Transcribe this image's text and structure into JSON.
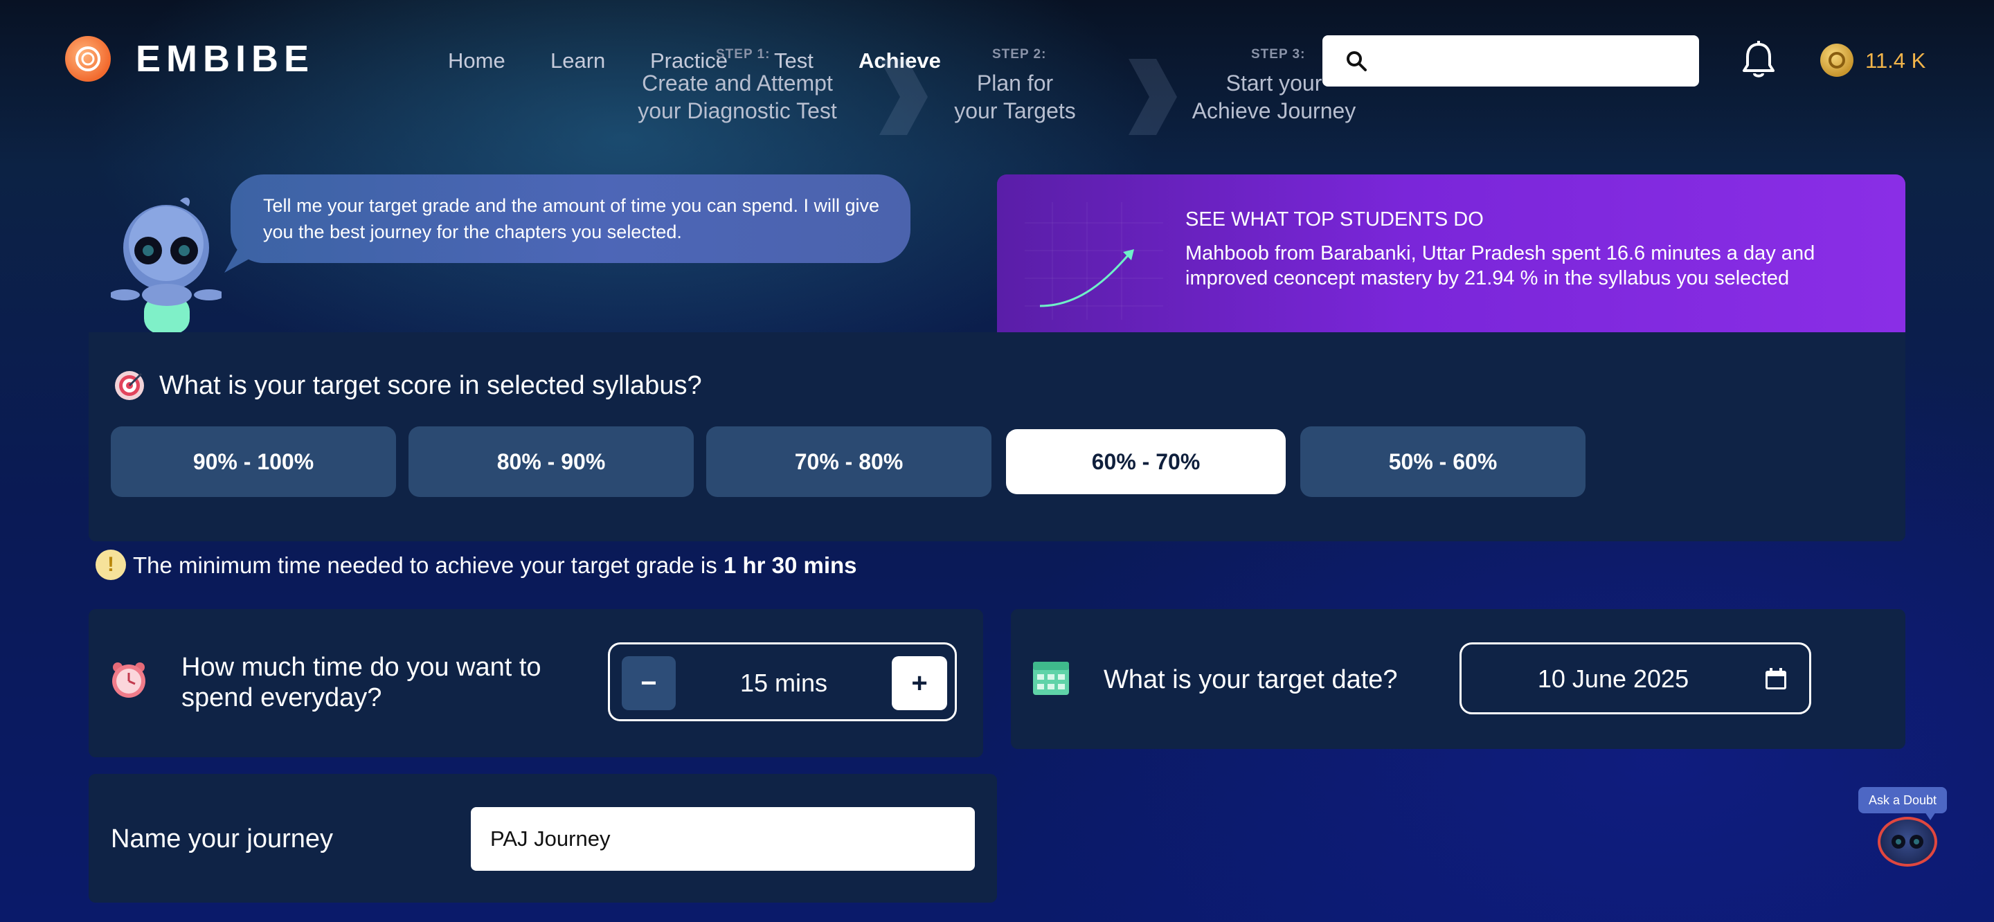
{
  "header": {
    "brand": "EMBIBE",
    "nav": [
      "Home",
      "Learn",
      "Practice",
      "Test",
      "Achieve"
    ],
    "active_nav": "Achieve",
    "coins": "11.4 K"
  },
  "steps": [
    {
      "label": "STEP 1:",
      "line1": "Create and Attempt",
      "line2": "your Diagnostic Test"
    },
    {
      "label": "STEP 2:",
      "line1": "Plan for",
      "line2": "your Targets"
    },
    {
      "label": "STEP 3:",
      "line1": "Start your",
      "line2": "Achieve Journey"
    }
  ],
  "bot_message": "Tell me your target grade and the amount of time you can spend. I will give you the best journey for the chapters you selected.",
  "promo": {
    "title": "SEE WHAT TOP STUDENTS DO",
    "text": "Mahboob from Barabanki, Uttar Pradesh spent 16.6 minutes a day and improved ceoncept mastery by 21.94 % in the syllabus you selected"
  },
  "score": {
    "question": "What is your target score in selected syllabus?",
    "options": [
      "90% - 100%",
      "80% - 90%",
      "70% - 80%",
      "60% - 70%",
      "50% - 60%"
    ],
    "selected": "60% - 70%"
  },
  "min_time": {
    "text": "The minimum time needed to achieve your target grade is ",
    "value": "1 hr 30 mins"
  },
  "daily_time": {
    "question_line1": "How much time do you want to",
    "question_line2": "spend everyday?",
    "minus": "−",
    "plus": "+",
    "value": "15 mins"
  },
  "target_date": {
    "question": "What is your target date?",
    "value": "10 June 2025"
  },
  "journey": {
    "label": "Name your journey",
    "value": "PAJ Journey"
  },
  "ask_doubt": "Ask a Doubt",
  "colors": {
    "accent_orange": "#f26a2e",
    "coin_gold": "#f3b54a",
    "promo_purple": "#7a26d9",
    "panel_bg": "#0f2346",
    "option_bg": "#2b4a72"
  }
}
